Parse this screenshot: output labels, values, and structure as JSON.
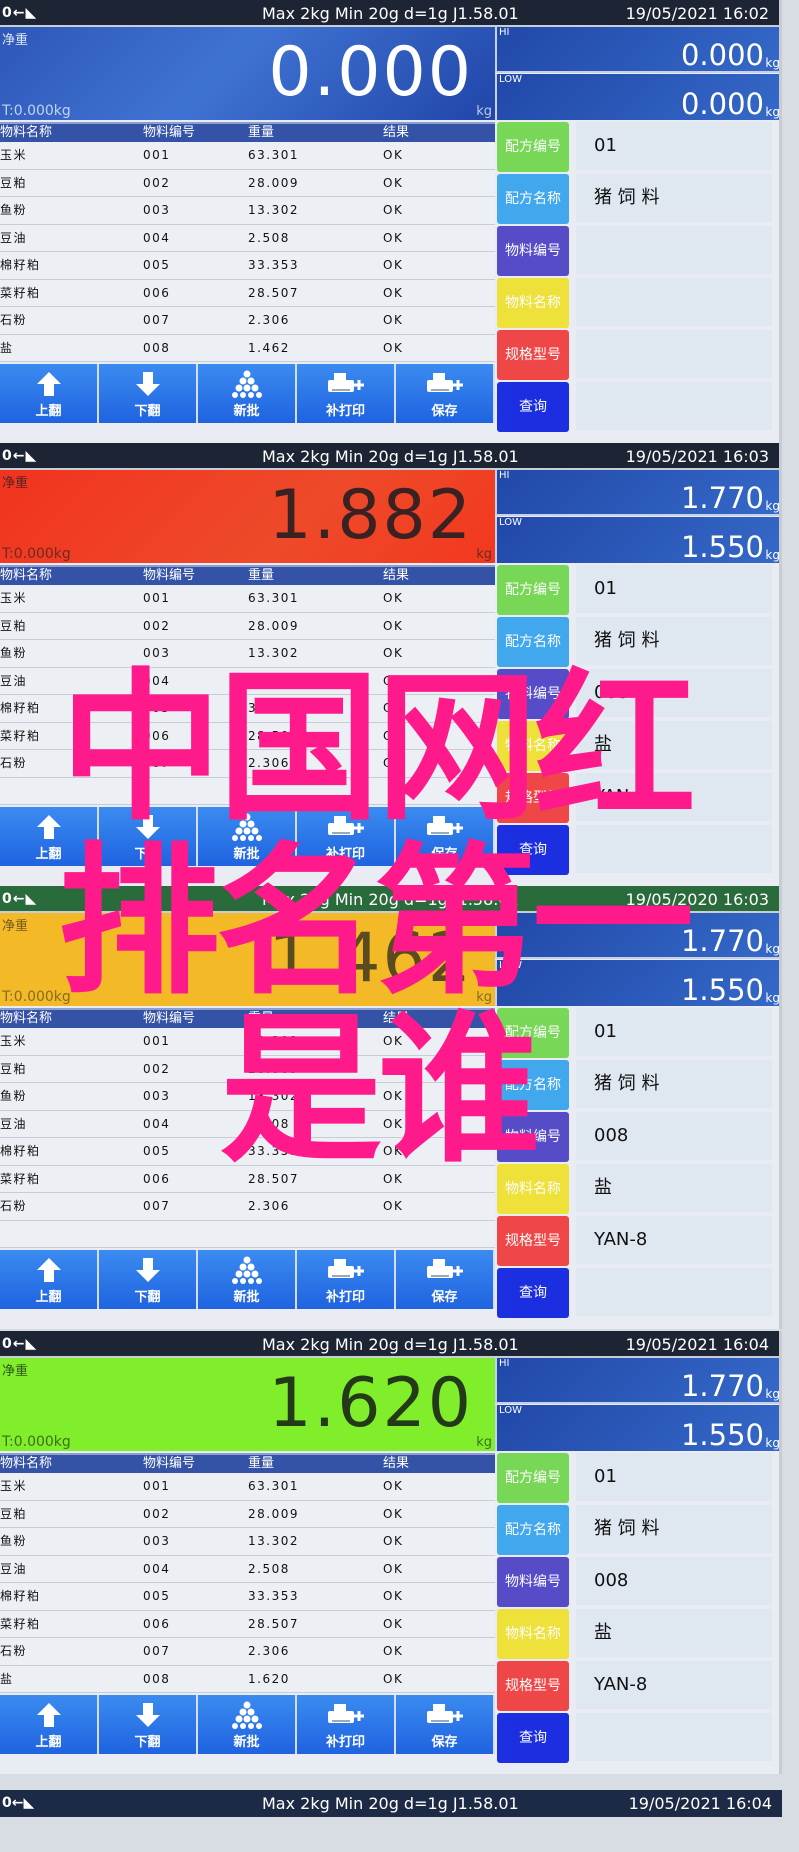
{
  "status": {
    "icons_text": "0←◣",
    "spec": "Max 2kg  Min 20g  d=1g    J1.58.01"
  },
  "labels": {
    "net": "净重",
    "tare": "T:0.000kg",
    "unit": "kg",
    "hi": "HI",
    "low": "LOW"
  },
  "table": {
    "headers": [
      "物料名称",
      "物料编号",
      "重量",
      "结果"
    ]
  },
  "toolbar": {
    "buttons": [
      "上翻",
      "下翻",
      "新批",
      "补打印",
      "保存"
    ]
  },
  "side": {
    "buttons": [
      "配方编号",
      "配方名称",
      "物料编号",
      "物料名称",
      "规格型号",
      "查询"
    ],
    "colors": [
      "#6fd64a",
      "#33a3ee",
      "#4a3fc4",
      "#efe02a",
      "#f03a3a",
      "#0a1fe0"
    ]
  },
  "screens": [
    {
      "datetime": "19/05/2021  16:02",
      "net_value": "0.000",
      "hi_value": "0.000",
      "low_value": "0.000",
      "theme": "blue",
      "rows": [
        [
          "玉米",
          "001",
          "63.301",
          "OK"
        ],
        [
          "豆粕",
          "002",
          "28.009",
          "OK"
        ],
        [
          "鱼粉",
          "003",
          "13.302",
          "OK"
        ],
        [
          "豆油",
          "004",
          "2.508",
          "OK"
        ],
        [
          "棉籽粕",
          "005",
          "33.353",
          "OK"
        ],
        [
          "菜籽粕",
          "006",
          "28.507",
          "OK"
        ],
        [
          "石粉",
          "007",
          "2.306",
          "OK"
        ],
        [
          "盐",
          "008",
          "1.462",
          "OK"
        ]
      ],
      "fields": [
        "01",
        "猪 饲 料",
        "",
        "",
        "",
        ""
      ]
    },
    {
      "datetime": "19/05/2021  16:03",
      "net_value": "1.882",
      "hi_value": "1.770",
      "low_value": "1.550",
      "theme": "red",
      "rows": [
        [
          "玉米",
          "001",
          "63.301",
          "OK"
        ],
        [
          "豆粕",
          "002",
          "28.009",
          "OK"
        ],
        [
          "鱼粉",
          "003",
          "13.302",
          "OK"
        ],
        [
          "豆油",
          "004",
          "2.508",
          "OK"
        ],
        [
          "棉籽粕",
          "005",
          "33.353",
          "OK"
        ],
        [
          "菜籽粕",
          "006",
          "28.507",
          "OK"
        ],
        [
          "石粉",
          "007",
          "2.306",
          "OK"
        ],
        [
          "",
          "",
          "",
          ""
        ]
      ],
      "fields": [
        "01",
        "猪 饲 料",
        "008",
        "盐",
        "YAN-8",
        ""
      ]
    },
    {
      "datetime": "19/05/2020  16:03",
      "net_value": "1.462",
      "hi_value": "1.770",
      "low_value": "1.550",
      "theme": "yellow",
      "rows": [
        [
          "玉米",
          "001",
          "63.301",
          "OK"
        ],
        [
          "豆粕",
          "002",
          "28.009",
          "OK"
        ],
        [
          "鱼粉",
          "003",
          "13.302",
          "OK"
        ],
        [
          "豆油",
          "004",
          "2.508",
          "OK"
        ],
        [
          "棉籽粕",
          "005",
          "33.353",
          "OK"
        ],
        [
          "菜籽粕",
          "006",
          "28.507",
          "OK"
        ],
        [
          "石粉",
          "007",
          "2.306",
          "OK"
        ],
        [
          "",
          "",
          "",
          ""
        ]
      ],
      "fields": [
        "01",
        "猪 饲 料",
        "008",
        "盐",
        "YAN-8",
        ""
      ]
    },
    {
      "datetime": "19/05/2021  16:04",
      "net_value": "1.620",
      "hi_value": "1.770",
      "low_value": "1.550",
      "theme": "lime",
      "rows": [
        [
          "玉米",
          "001",
          "63.301",
          "OK"
        ],
        [
          "豆粕",
          "002",
          "28.009",
          "OK"
        ],
        [
          "鱼粉",
          "003",
          "13.302",
          "OK"
        ],
        [
          "豆油",
          "004",
          "2.508",
          "OK"
        ],
        [
          "棉籽粕",
          "005",
          "33.353",
          "OK"
        ],
        [
          "菜籽粕",
          "006",
          "28.507",
          "OK"
        ],
        [
          "石粉",
          "007",
          "2.306",
          "OK"
        ],
        [
          "盐",
          "008",
          "1.620",
          "OK"
        ]
      ],
      "fields": [
        "01",
        "猪 饲 料",
        "008",
        "盐",
        "YAN-8",
        ""
      ]
    }
  ],
  "bottom_status": {
    "datetime": "19/05/2021  16:04"
  },
  "overlay": {
    "line1": "中国网红",
    "line2": "排名第一",
    "line3": "是谁"
  }
}
